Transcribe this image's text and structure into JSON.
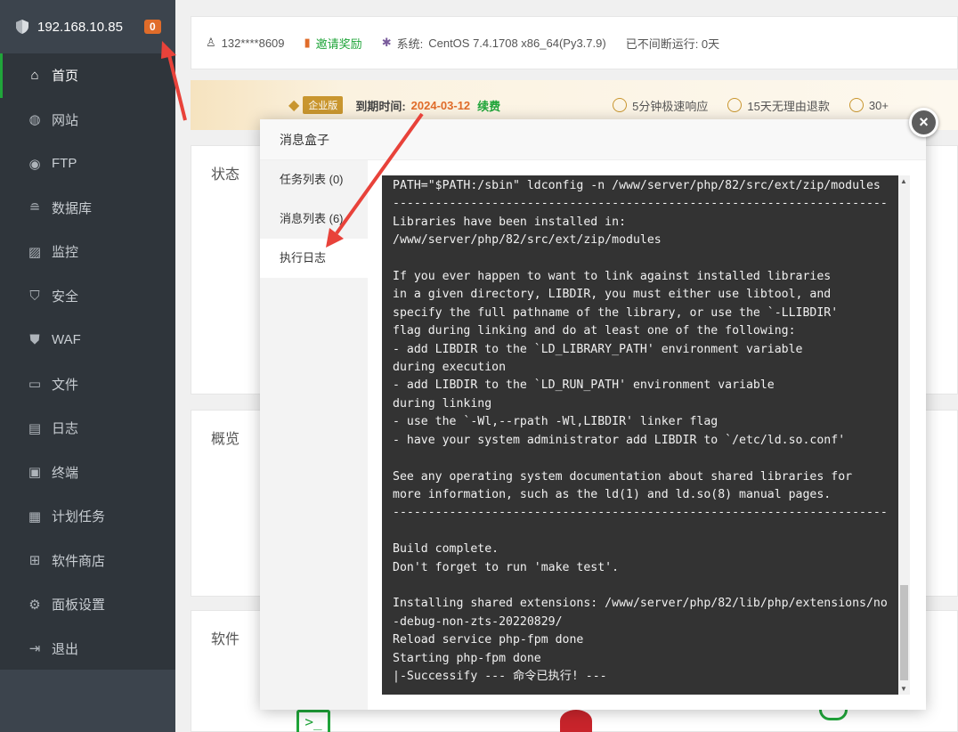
{
  "sidebar": {
    "ip": "192.168.10.85",
    "badge": "0",
    "items": [
      {
        "label": "首页",
        "icon": "home-icon"
      },
      {
        "label": "网站",
        "icon": "globe-icon"
      },
      {
        "label": "FTP",
        "icon": "ftp-icon"
      },
      {
        "label": "数据库",
        "icon": "database-icon"
      },
      {
        "label": "监控",
        "icon": "monitor-icon"
      },
      {
        "label": "安全",
        "icon": "shield-icon"
      },
      {
        "label": "WAF",
        "icon": "waf-shield-icon"
      },
      {
        "label": "文件",
        "icon": "folder-icon"
      },
      {
        "label": "日志",
        "icon": "log-icon"
      },
      {
        "label": "终端",
        "icon": "terminal-icon"
      },
      {
        "label": "计划任务",
        "icon": "calendar-icon"
      },
      {
        "label": "软件商店",
        "icon": "apps-icon"
      },
      {
        "label": "面板设置",
        "icon": "gear-icon"
      },
      {
        "label": "退出",
        "icon": "logout-icon"
      }
    ]
  },
  "topbar": {
    "user": "132****8609",
    "invite": "邀请奖励",
    "system_label": "系统:",
    "system": "CentOS 7.4.1708 x86_64(Py3.7.9)",
    "uptime": "已不间断运行: 0天"
  },
  "promo": {
    "edition": "企业版",
    "expire_label": "到期时间:",
    "expire_date": "2024-03-12",
    "renew": "续费",
    "feature1": "5分钟极速响应",
    "feature2": "15天无理由退款",
    "feature3": "30+"
  },
  "panels": {
    "status": "状态",
    "overview": "概览",
    "software": "软件"
  },
  "modal": {
    "title": "消息盒子",
    "tabs": [
      "任务列表 (0)",
      "消息列表 (6)",
      "执行日志"
    ],
    "close": "×",
    "log": "PATH=\"$PATH:/sbin\" ldconfig -n /www/server/php/82/src/ext/zip/modules\n----------------------------------------------------------------------\nLibraries have been installed in:\n/www/server/php/82/src/ext/zip/modules\n\nIf you ever happen to want to link against installed libraries\nin a given directory, LIBDIR, you must either use libtool, and\nspecify the full pathname of the library, or use the `-LLIBDIR'\nflag during linking and do at least one of the following:\n- add LIBDIR to the `LD_LIBRARY_PATH' environment variable\nduring execution\n- add LIBDIR to the `LD_RUN_PATH' environment variable\nduring linking\n- use the `-Wl,--rpath -Wl,LIBDIR' linker flag\n- have your system administrator add LIBDIR to `/etc/ld.so.conf'\n\nSee any operating system documentation about shared libraries for\nmore information, such as the ld(1) and ld.so(8) manual pages.\n----------------------------------------------------------------------\n\nBuild complete.\nDon't forget to run 'make test'.\n\nInstalling shared extensions: /www/server/php/82/lib/php/extensions/no\n-debug-non-zts-20220829/\nReload service php-fpm done\nStarting php-fpm done\n|-Successify --- 命令已执行! ---"
  },
  "colors": {
    "accent": "#20a53a",
    "sidebar": "#3c444d",
    "badge": "#e06c2a",
    "arrow": "#e8423a"
  }
}
